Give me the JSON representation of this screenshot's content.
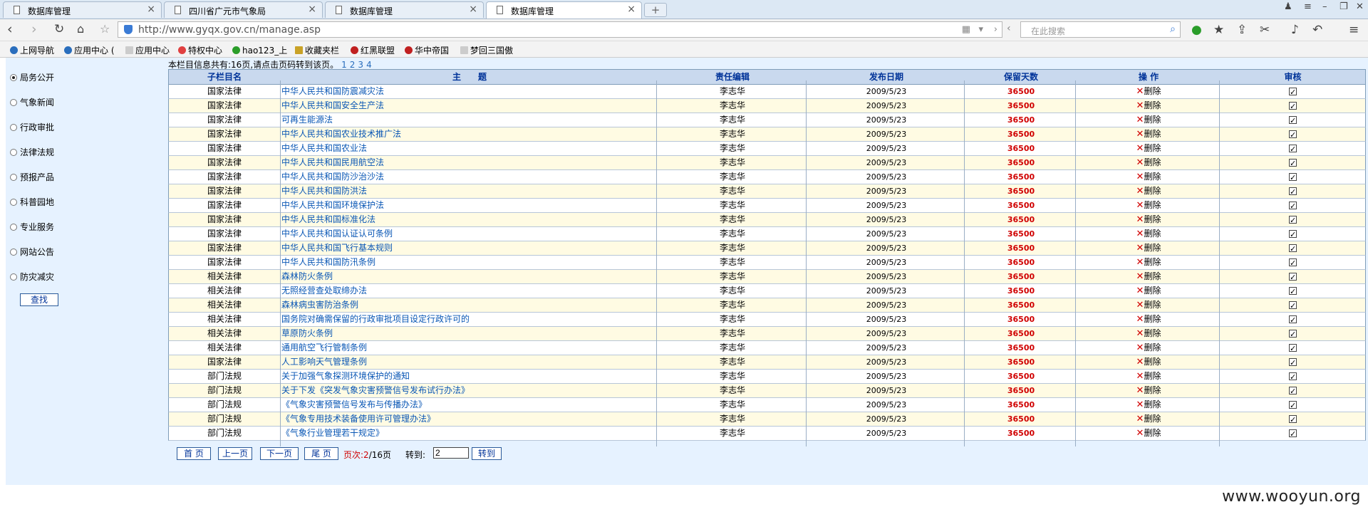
{
  "tabs": [
    {
      "title": "数据库管理",
      "active": false
    },
    {
      "title": "四川省广元市气象局",
      "active": false
    },
    {
      "title": "数据库管理",
      "active": false
    },
    {
      "title": "数据库管理",
      "active": true
    }
  ],
  "address": {
    "url": "http://www.gyqx.gov.cn/manage.asp"
  },
  "search": {
    "placeholder": "在此搜索"
  },
  "bookmarks": [
    {
      "label": "上网导航",
      "color": "#2a6ebd"
    },
    {
      "label": "应用中心 (",
      "color": "#2a6ebd"
    },
    {
      "label": "应用中心",
      "color": "#888888"
    },
    {
      "label": "特权中心",
      "color": "#e04040"
    },
    {
      "label": "hao123_上",
      "color": "#2a9d2a"
    },
    {
      "label": "收藏夹栏",
      "color": "#c9a227"
    },
    {
      "label": "红黑联盟",
      "color": "#c02020"
    },
    {
      "label": "华中帝国",
      "color": "#c02020"
    },
    {
      "label": "梦回三国傲",
      "color": "#888888"
    }
  ],
  "sidebar": {
    "items": [
      {
        "label": "局务公开",
        "selected": true
      },
      {
        "label": "气象新闻",
        "selected": false
      },
      {
        "label": "行政审批",
        "selected": false
      },
      {
        "label": "法律法规",
        "selected": false
      },
      {
        "label": "预报产品",
        "selected": false
      },
      {
        "label": "科普园地",
        "selected": false
      },
      {
        "label": "专业服务",
        "selected": false
      },
      {
        "label": "网站公告",
        "selected": false
      },
      {
        "label": "防灾减灾",
        "selected": false
      }
    ],
    "search_label": "查找"
  },
  "info": {
    "text": "本栏目信息共有:16页,请点击页码转到该页。",
    "pages": [
      "1",
      "2",
      "3",
      "4"
    ]
  },
  "table": {
    "headers": [
      "子栏目名",
      "主　　题",
      "责任编辑",
      "发布日期",
      "保留天数",
      "操 作",
      "审核"
    ],
    "rows": [
      {
        "category": "国家法律",
        "title": "中华人民共和国防震减灾法",
        "editor": "李志华",
        "date": "2009/5/23",
        "days": "36500",
        "action": "删除"
      },
      {
        "category": "国家法律",
        "title": "中华人民共和国安全生产法",
        "editor": "李志华",
        "date": "2009/5/23",
        "days": "36500",
        "action": "删除"
      },
      {
        "category": "国家法律",
        "title": "可再生能源法",
        "editor": "李志华",
        "date": "2009/5/23",
        "days": "36500",
        "action": "删除"
      },
      {
        "category": "国家法律",
        "title": "中华人民共和国农业技术推广法",
        "editor": "李志华",
        "date": "2009/5/23",
        "days": "36500",
        "action": "删除"
      },
      {
        "category": "国家法律",
        "title": "中华人民共和国农业法",
        "editor": "李志华",
        "date": "2009/5/23",
        "days": "36500",
        "action": "删除"
      },
      {
        "category": "国家法律",
        "title": "中华人民共和国民用航空法",
        "editor": "李志华",
        "date": "2009/5/23",
        "days": "36500",
        "action": "删除"
      },
      {
        "category": "国家法律",
        "title": "中华人民共和国防沙治沙法",
        "editor": "李志华",
        "date": "2009/5/23",
        "days": "36500",
        "action": "删除"
      },
      {
        "category": "国家法律",
        "title": "中华人民共和国防洪法",
        "editor": "李志华",
        "date": "2009/5/23",
        "days": "36500",
        "action": "删除"
      },
      {
        "category": "国家法律",
        "title": "中华人民共和国环境保护法",
        "editor": "李志华",
        "date": "2009/5/23",
        "days": "36500",
        "action": "删除"
      },
      {
        "category": "国家法律",
        "title": "中华人民共和国标准化法",
        "editor": "李志华",
        "date": "2009/5/23",
        "days": "36500",
        "action": "删除"
      },
      {
        "category": "国家法律",
        "title": "中华人民共和国认证认可条例",
        "editor": "李志华",
        "date": "2009/5/23",
        "days": "36500",
        "action": "删除"
      },
      {
        "category": "国家法律",
        "title": "中华人民共和国飞行基本规则",
        "editor": "李志华",
        "date": "2009/5/23",
        "days": "36500",
        "action": "删除"
      },
      {
        "category": "国家法律",
        "title": "中华人民共和国防汛条例",
        "editor": "李志华",
        "date": "2009/5/23",
        "days": "36500",
        "action": "删除"
      },
      {
        "category": "相关法律",
        "title": "森林防火条例",
        "editor": "李志华",
        "date": "2009/5/23",
        "days": "36500",
        "action": "删除"
      },
      {
        "category": "相关法律",
        "title": "无照经营查处取缔办法",
        "editor": "李志华",
        "date": "2009/5/23",
        "days": "36500",
        "action": "删除"
      },
      {
        "category": "相关法律",
        "title": "森林病虫害防治条例",
        "editor": "李志华",
        "date": "2009/5/23",
        "days": "36500",
        "action": "删除"
      },
      {
        "category": "相关法律",
        "title": "国务院对确需保留的行政审批项目设定行政许可的",
        "editor": "李志华",
        "date": "2009/5/23",
        "days": "36500",
        "action": "删除"
      },
      {
        "category": "相关法律",
        "title": "草原防火条例",
        "editor": "李志华",
        "date": "2009/5/23",
        "days": "36500",
        "action": "删除"
      },
      {
        "category": "相关法律",
        "title": "通用航空飞行管制条例",
        "editor": "李志华",
        "date": "2009/5/23",
        "days": "36500",
        "action": "删除"
      },
      {
        "category": "国家法律",
        "title": "人工影响天气管理条例",
        "editor": "李志华",
        "date": "2009/5/23",
        "days": "36500",
        "action": "删除"
      },
      {
        "category": "部门法规",
        "title": "关于加强气象探测环境保护的通知",
        "editor": "李志华",
        "date": "2009/5/23",
        "days": "36500",
        "action": "删除"
      },
      {
        "category": "部门法规",
        "title": "关于下发《突发气象灾害预警信号发布试行办法》",
        "editor": "李志华",
        "date": "2009/5/23",
        "days": "36500",
        "action": "删除"
      },
      {
        "category": "部门法规",
        "title": "《气象灾害预警信号发布与传播办法》",
        "editor": "李志华",
        "date": "2009/5/23",
        "days": "36500",
        "action": "删除"
      },
      {
        "category": "部门法规",
        "title": "《气象专用技术装备使用许可管理办法》",
        "editor": "李志华",
        "date": "2009/5/23",
        "days": "36500",
        "action": "删除"
      },
      {
        "category": "部门法规",
        "title": "《气象行业管理若干规定》",
        "editor": "李志华",
        "date": "2009/5/23",
        "days": "36500",
        "action": "删除"
      }
    ]
  },
  "pager": {
    "first": "首 页",
    "prev": "上一页",
    "next": "下一页",
    "last": "尾 页",
    "page_label": "页次:",
    "current": "2",
    "total": "/16页",
    "goto_label": "转到:",
    "input_value": "2",
    "go_button": "转到"
  },
  "watermark": "www.wooyun.org",
  "colors": {
    "accent": "#0a57b5",
    "days": "#d00000",
    "odd_row": "#ffffff",
    "even_row": "#fffbe3"
  }
}
